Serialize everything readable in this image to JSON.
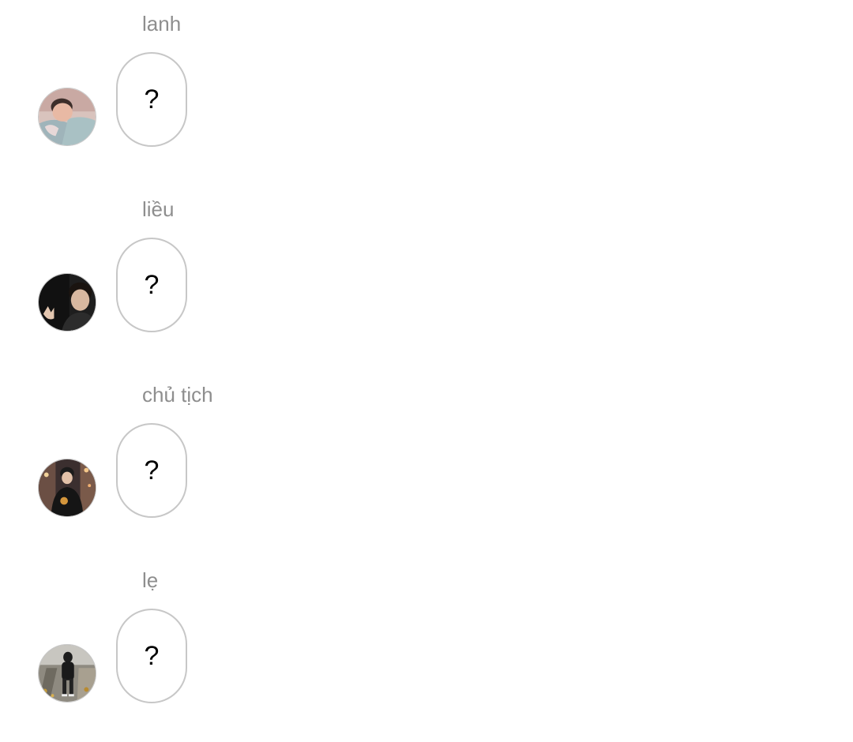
{
  "messages": [
    {
      "sender": "lanh",
      "text": "?",
      "avatar": "avatar-baby-sleeping"
    },
    {
      "sender": "liều",
      "text": "?",
      "avatar": "avatar-selfie-night"
    },
    {
      "sender": "chủ tịch",
      "text": "?",
      "avatar": "avatar-street-night"
    },
    {
      "sender": "lẹ",
      "text": "?",
      "avatar": "avatar-sidewalk-autumn"
    }
  ],
  "colors": {
    "sender_name": "#8e8e8e",
    "bubble_border": "#c7c7c7",
    "message_text": "#000000",
    "background": "#ffffff"
  }
}
